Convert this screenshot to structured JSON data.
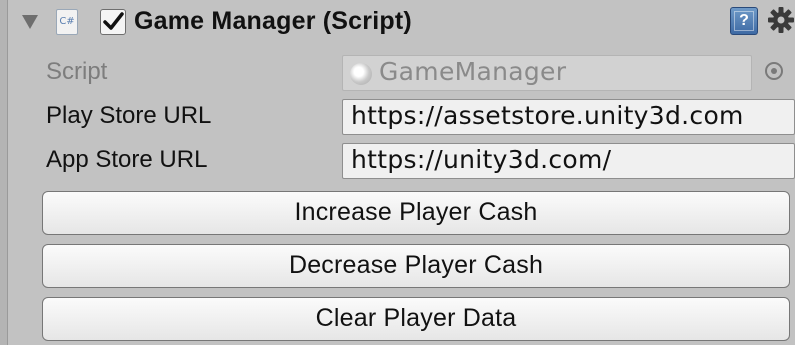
{
  "component": {
    "title": "Game Manager (Script)",
    "enabled": true,
    "icons": {
      "foldout": "foldout-arrow-icon",
      "script": "csharp-script-icon",
      "help": "help-book-icon",
      "settings": "gear-icon"
    },
    "cs_icon_text": "C#",
    "help_icon_text": "?"
  },
  "fields": {
    "script": {
      "label": "Script",
      "value": "GameManager"
    },
    "play_store_url": {
      "label": "Play Store URL",
      "value": "https://assetstore.unity3d.com"
    },
    "app_store_url": {
      "label": "App Store URL",
      "value": "https://unity3d.com/"
    }
  },
  "buttons": {
    "increase_cash": "Increase Player Cash",
    "decrease_cash": "Decrease Player Cash",
    "clear_data": "Clear Player Data"
  },
  "colors": {
    "panel_bg": "#c2c2c2",
    "field_bg": "#f0f0f0",
    "help_blue": "#3e6aa4"
  }
}
